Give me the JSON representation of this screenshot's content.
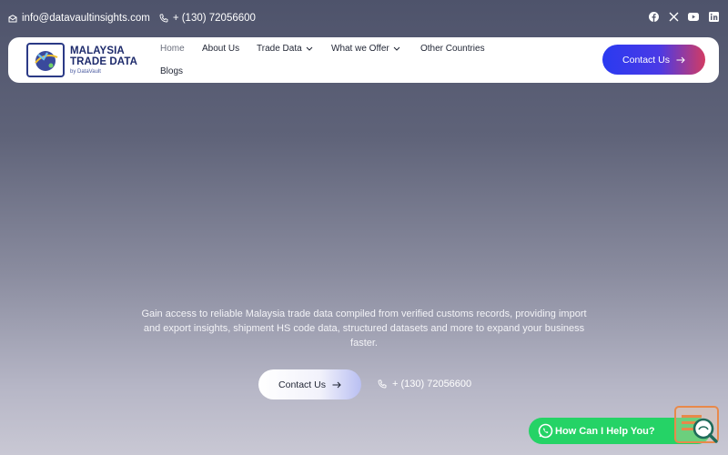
{
  "topbar": {
    "email": "info@datavaultinsights.com",
    "phone": "+ (130) 72056600",
    "social": [
      "facebook-icon",
      "x-icon",
      "youtube-icon",
      "linkedin-icon"
    ]
  },
  "logo": {
    "line1": "MALAYSIA",
    "line2": "TRADE DATA",
    "line3": "by DataVault"
  },
  "nav": {
    "home": "Home",
    "about": "About Us",
    "trade_data": "Trade Data",
    "what_we_offer": "What we Offer",
    "other_countries": "Other Countries",
    "blogs": "Blogs"
  },
  "header_contact": "Contact Us",
  "hero": {
    "description": "Gain access to reliable Malaysia trade data compiled from verified customs records, providing import and export insights, shipment HS code data, structured datasets and more to expand your business faster.",
    "contact_label": "Contact Us",
    "phone": "+ (130) 72056600"
  },
  "whatsapp": {
    "label": "How Can I Help You?"
  },
  "colors": {
    "accent_blue": "#2a3af0",
    "accent_red": "#d23b63",
    "whatsapp_green": "#25d366",
    "logo_navy": "#1d2a6b"
  }
}
